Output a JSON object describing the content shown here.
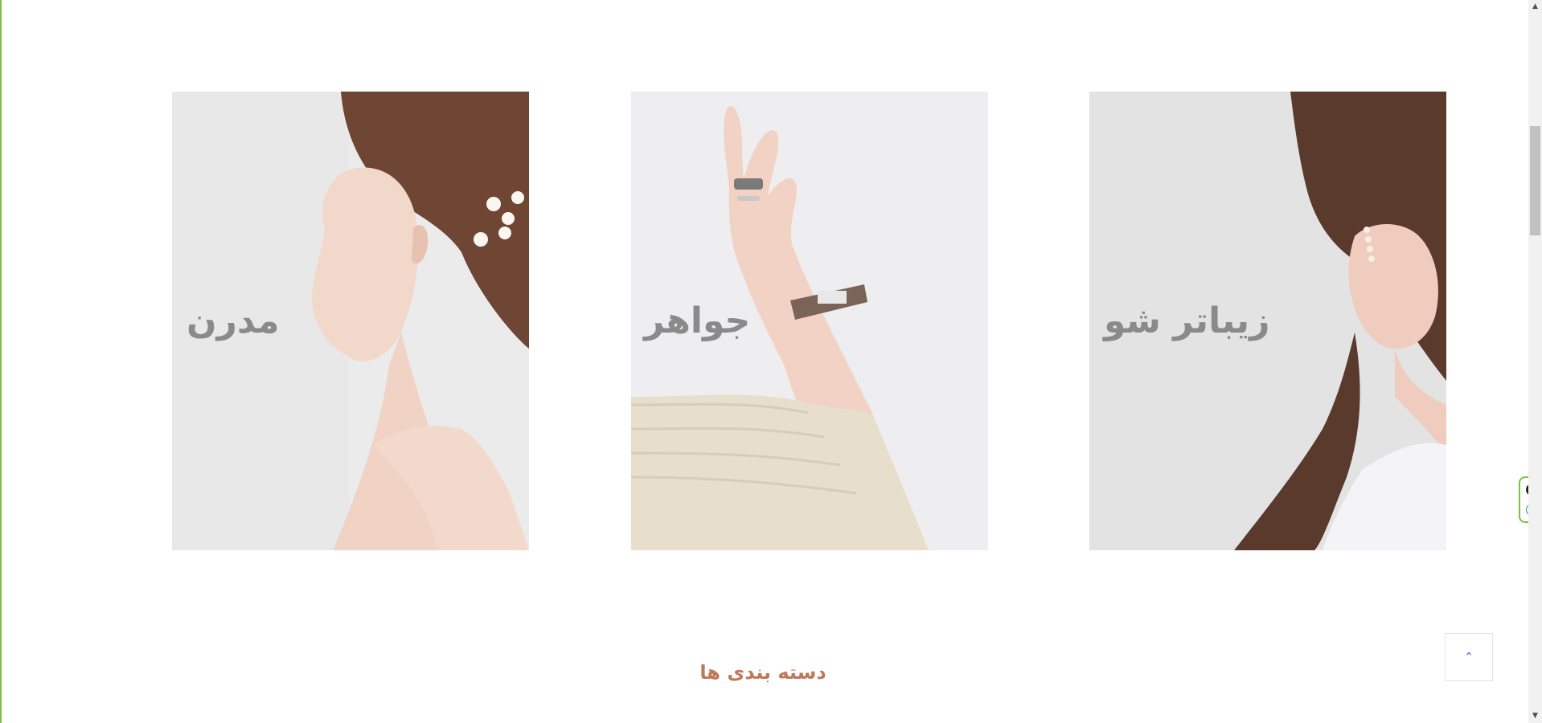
{
  "banners": [
    {
      "label": "مدرن"
    },
    {
      "label": "جواهر"
    },
    {
      "label": "زیباتر شو"
    }
  ],
  "section": {
    "title": "دسته بندی ها"
  },
  "scroll_top": {
    "icon": "chevron-up-icon",
    "glyph": "⌃"
  },
  "side_widget": {
    "close_glyph": "✕",
    "e_glyph": "e"
  },
  "scrollbar": {
    "up_glyph": "▲",
    "down_glyph": "▼"
  },
  "colors": {
    "accent": "#7cc142",
    "title": "#c0785a",
    "label": "#8a8a8a"
  }
}
